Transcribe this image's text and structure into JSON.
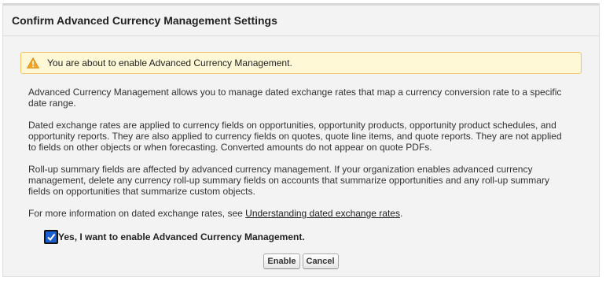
{
  "dialog": {
    "title": "Confirm Advanced Currency Management Settings"
  },
  "warning": {
    "icon": "warning-icon",
    "text": "You are about to enable Advanced Currency Management."
  },
  "paragraphs": {
    "p1": "Advanced Currency Management allows you to manage dated exchange rates that map a currency conversion rate to a specific date range.",
    "p2": "Dated exchange rates are applied to currency fields on opportunities, opportunity products, opportunity product schedules, and opportunity reports. They are also applied to currency fields on quotes, quote line items, and quote reports. They are not applied to fields on other objects or when forecasting. Converted amounts do not appear on quote PDFs.",
    "p3": "Roll-up summary fields are affected by advanced currency management. If your organization enables advanced currency management, delete any currency roll-up summary fields on accounts that summarize opportunities and any roll-up summary fields on opportunities that summarize custom objects.",
    "p4_prefix": "For more information on dated exchange rates, see ",
    "p4_link": "Understanding dated exchange rates",
    "p4_suffix": "."
  },
  "confirm": {
    "checked": true,
    "label": "Yes, I want to enable Advanced Currency Management."
  },
  "buttons": {
    "enable": "Enable",
    "cancel": "Cancel"
  },
  "colors": {
    "warning_bg": "#fff8d6",
    "warning_border": "#f0c36d",
    "checkbox": "#1b5fd1"
  }
}
